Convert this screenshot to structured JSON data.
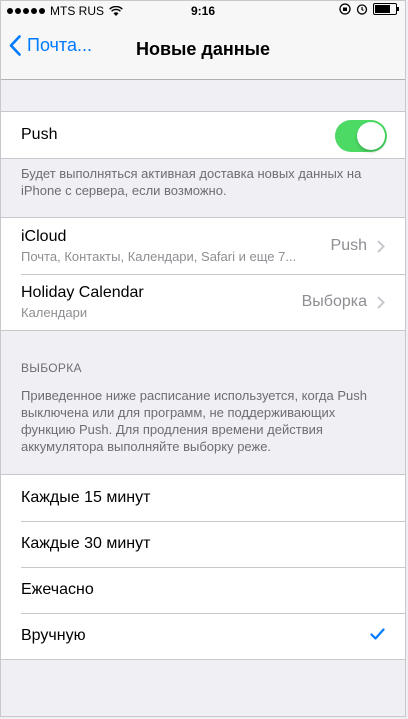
{
  "status_bar": {
    "carrier": "MTS RUS",
    "time": "9:16",
    "battery_level": 0.85
  },
  "nav": {
    "back_label": "Почта...",
    "title": "Новые данные"
  },
  "push": {
    "label": "Push",
    "enabled": true,
    "description": "Будет выполняться активная доставка новых данных на iPhone с сервера, если возможно."
  },
  "accounts": [
    {
      "name": "iCloud",
      "subtitle": "Почта, Контакты, Календари, Safari и еще 7...",
      "mode": "Push"
    },
    {
      "name": "Holiday Calendar",
      "subtitle": "Календари",
      "mode": "Выборка"
    }
  ],
  "fetch": {
    "header": "ВЫБОРКА",
    "description": "Приведенное ниже расписание используется, когда Push выключена или для программ, не поддерживающих функцию Push. Для продления времени действия аккумулятора выполняйте выборку реже.",
    "options": [
      {
        "label": "Каждые 15 минут",
        "selected": false
      },
      {
        "label": "Каждые 30 минут",
        "selected": false
      },
      {
        "label": "Ежечасно",
        "selected": false
      },
      {
        "label": "Вручную",
        "selected": true
      }
    ]
  },
  "colors": {
    "accent": "#007aff",
    "toggle_on": "#4cd964",
    "background": "#efeff4"
  }
}
